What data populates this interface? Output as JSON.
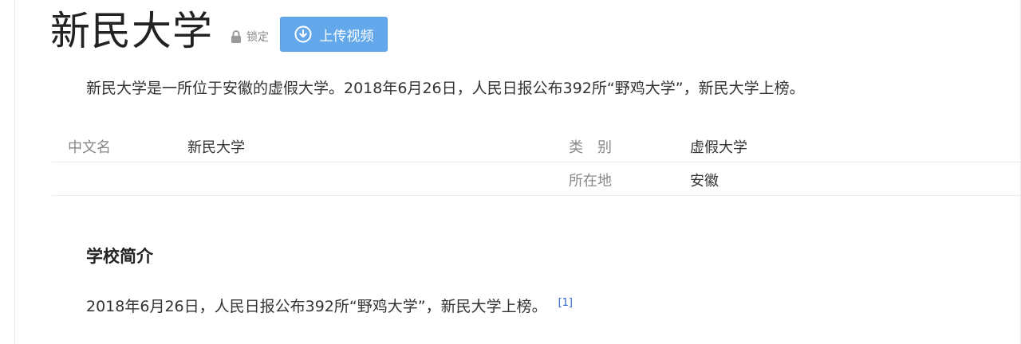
{
  "entry": {
    "title": "新民大学",
    "lock_label": "锁定",
    "upload_label": "上传视频"
  },
  "summary": "新民大学是一所位于安徽的虚假大学。2018年6月26日，人民日报公布392所“野鸡大学”，新民大学上榜。",
  "infobox": {
    "rows": [
      {
        "label1": "中文名",
        "value1": "新民大学",
        "label2": "类　别",
        "value2": "虚假大学"
      },
      {
        "label1": "",
        "value1": "",
        "label2": "所在地",
        "value2": "安徽"
      }
    ]
  },
  "section": {
    "title": "学校简介",
    "text": "2018年6月26日，人民日报公布392所“野鸡大学”，新民大学上榜。",
    "ref": "[1]"
  },
  "colors": {
    "button": "#62a8eb",
    "link": "#3366cc",
    "muted": "#888888"
  },
  "icons": {
    "lock": "lock-icon",
    "upload": "circle-arrow-down-icon"
  }
}
